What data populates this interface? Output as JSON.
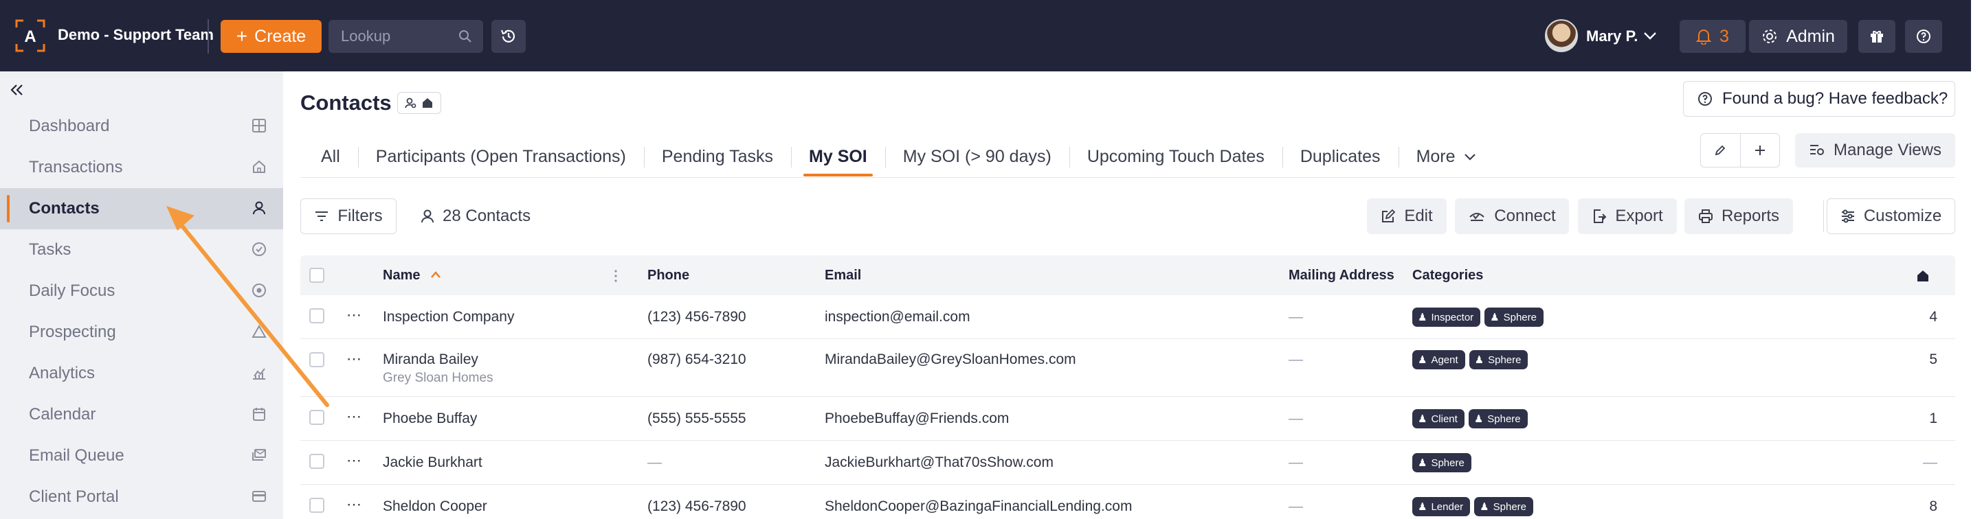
{
  "colors": {
    "topbar": "#22243a",
    "accent": "#f07a1e",
    "sidebar": "#f0f1f4",
    "chip": "#2e3147"
  },
  "topbar": {
    "logo_letter": "A",
    "team_name": "Demo - Support Team",
    "create_label": "Create",
    "lookup_placeholder": "Lookup",
    "user_name": "Mary P.",
    "notification_count": "3",
    "admin_label": "Admin"
  },
  "sidebar": {
    "items": [
      {
        "label": "Dashboard",
        "icon": "grid-icon"
      },
      {
        "label": "Transactions",
        "icon": "home-icon"
      },
      {
        "label": "Contacts",
        "icon": "person-icon",
        "active": true
      },
      {
        "label": "Tasks",
        "icon": "check-circle-icon"
      },
      {
        "label": "Daily Focus",
        "icon": "target-icon"
      },
      {
        "label": "Prospecting",
        "icon": "triangle-icon"
      },
      {
        "label": "Analytics",
        "icon": "chart-icon"
      },
      {
        "label": "Calendar",
        "icon": "calendar-icon"
      },
      {
        "label": "Email Queue",
        "icon": "mail-queue-icon"
      },
      {
        "label": "Client Portal",
        "icon": "card-icon"
      }
    ]
  },
  "page": {
    "title": "Contacts",
    "feedback_label": "Found a bug? Have feedback?"
  },
  "tabs": [
    {
      "label": "All"
    },
    {
      "label": "Participants (Open Transactions)"
    },
    {
      "label": "Pending Tasks"
    },
    {
      "label": "My SOI",
      "active": true
    },
    {
      "label": "My SOI (> 90 days)"
    },
    {
      "label": "Upcoming Touch Dates"
    },
    {
      "label": "Duplicates"
    },
    {
      "label": "More"
    }
  ],
  "toolbar": {
    "manage_views": "Manage Views",
    "filters": "Filters",
    "count": "28 Contacts",
    "edit": "Edit",
    "connect": "Connect",
    "export": "Export",
    "reports": "Reports",
    "customize": "Customize"
  },
  "table": {
    "columns": {
      "name": "Name",
      "phone": "Phone",
      "email": "Email",
      "mailing": "Mailing Address",
      "categories": "Categories"
    },
    "rows": [
      {
        "name": "Inspection Company",
        "company": "",
        "phone": "(123) 456-7890",
        "email": "inspection@email.com",
        "mailing": "—",
        "categories": [
          "Inspector",
          "Sphere"
        ],
        "count": "4"
      },
      {
        "name": "Miranda Bailey",
        "company": "Grey Sloan Homes",
        "phone": "(987) 654-3210",
        "email": "MirandaBailey@GreySloanHomes.com",
        "mailing": "—",
        "categories": [
          "Agent",
          "Sphere"
        ],
        "count": "5"
      },
      {
        "name": "Phoebe Buffay",
        "company": "",
        "phone": "(555) 555-5555",
        "email": "PhoebeBuffay@Friends.com",
        "mailing": "—",
        "categories": [
          "Client",
          "Sphere"
        ],
        "count": "1"
      },
      {
        "name": "Jackie Burkhart",
        "company": "",
        "phone": "—",
        "email": "JackieBurkhart@That70sShow.com",
        "mailing": "—",
        "categories": [
          "Sphere"
        ],
        "count": "—"
      },
      {
        "name": "Sheldon Cooper",
        "company": "",
        "phone": "(123) 456-7890",
        "email": "SheldonCooper@BazingaFinancialLending.com",
        "mailing": "—",
        "categories": [
          "Lender",
          "Sphere"
        ],
        "count": "8"
      }
    ]
  }
}
